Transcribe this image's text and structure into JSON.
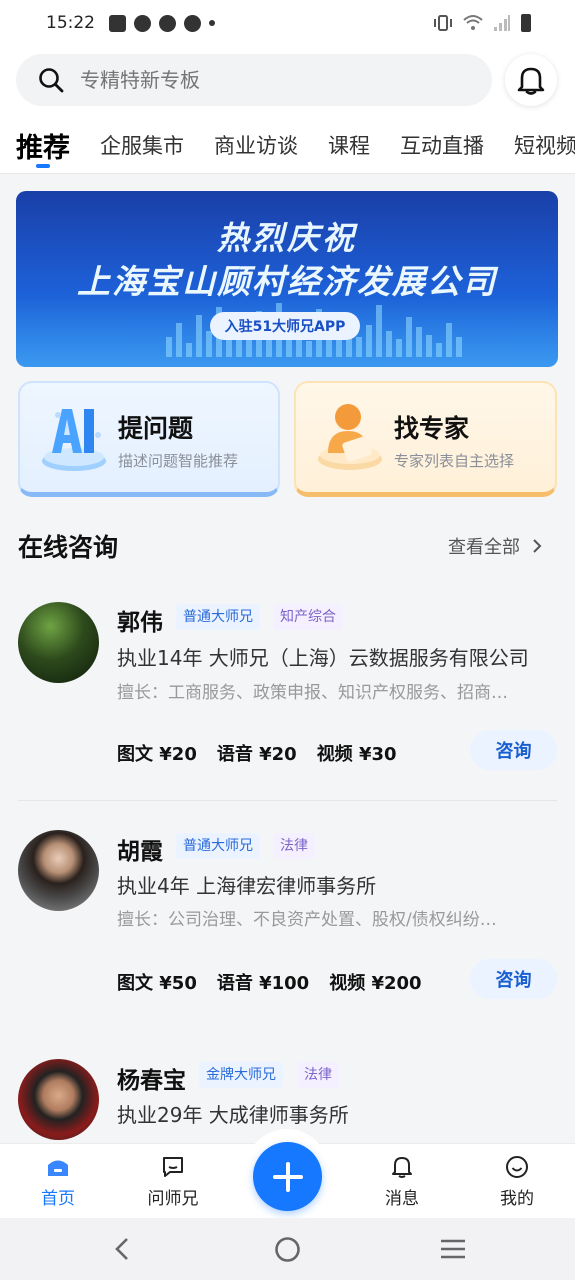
{
  "status_bar": {
    "time": "15:22"
  },
  "search": {
    "placeholder": "专精特新专板"
  },
  "tabs": [
    {
      "label": "推荐",
      "active": true
    },
    {
      "label": "企服集市"
    },
    {
      "label": "商业访谈"
    },
    {
      "label": "课程"
    },
    {
      "label": "互动直播"
    },
    {
      "label": "短视频"
    }
  ],
  "banner": {
    "line1": "热烈庆祝",
    "line2": "上海宝山顾村经济发展公司",
    "pill": "入驻51大师兄APP"
  },
  "cards": {
    "ask": {
      "title": "提问题",
      "subtitle": "描述问题智能推荐"
    },
    "expert": {
      "title": "找专家",
      "subtitle": "专家列表自主选择"
    }
  },
  "online": {
    "title": "在线咨询",
    "view_all": "查看全部"
  },
  "consultants": [
    {
      "name": "郭伟",
      "level": "普通大师兄",
      "category": "知产综合",
      "firm": "执业14年 大师兄（上海）云数据服务有限公司",
      "skill": "擅长：工商服务、政策申报、知识产权服务、招商…",
      "prices": [
        "图文 ¥20",
        "语音 ¥20",
        "视频 ¥30"
      ],
      "button": "咨询"
    },
    {
      "name": "胡霞",
      "level": "普通大师兄",
      "category": "法律",
      "firm": "执业4年 上海律宏律师事务所",
      "skill": "擅长：公司治理、不良资产处置、股权/债权纠纷…",
      "prices": [
        "图文 ¥50",
        "语音 ¥100",
        "视频 ¥200"
      ],
      "button": "咨询"
    },
    {
      "name": "杨春宝",
      "level": "金牌大师兄",
      "category": "法律",
      "firm": "执业29年 大成律师事务所"
    }
  ],
  "bottom_nav": [
    {
      "label": "首页",
      "icon": "home-icon",
      "active": true
    },
    {
      "label": "问师兄",
      "icon": "chat-icon"
    },
    {
      "label": "",
      "icon": "plus-icon"
    },
    {
      "label": "消息",
      "icon": "bell-icon"
    },
    {
      "label": "我的",
      "icon": "smile-icon"
    }
  ],
  "colors": {
    "accent": "#1677ff",
    "ask_card": "#e4f0ff",
    "expert_card": "#fff0d8"
  }
}
